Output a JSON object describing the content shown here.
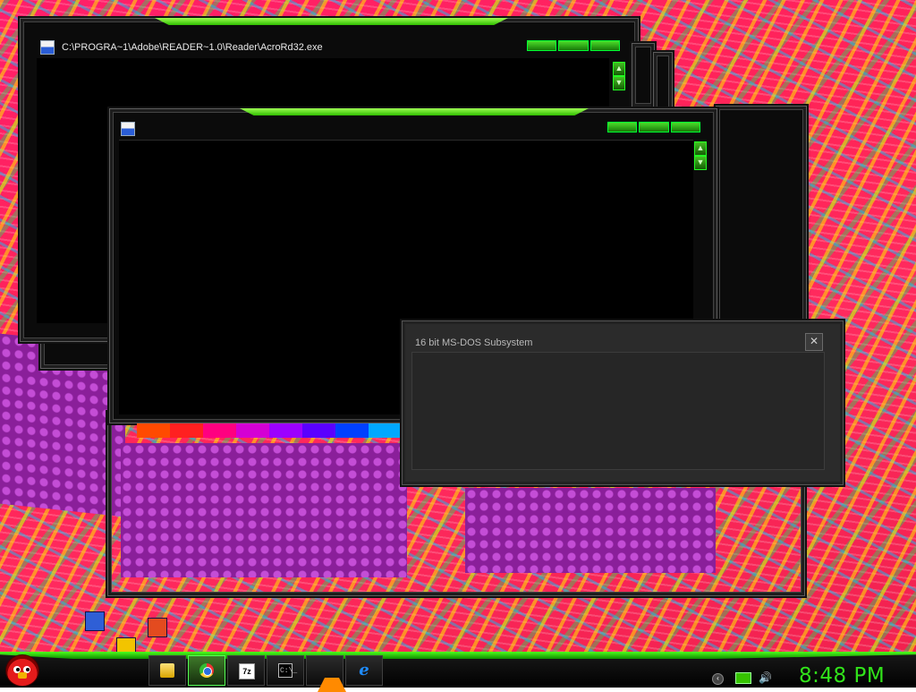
{
  "desktop": {
    "background": "psychedelic wallpaper",
    "accent_color": "#3cdc14"
  },
  "windows": {
    "acrobat": {
      "title": "C:\\PROGRA~1\\Adobe\\READER~1.0\\Reader\\AcroRd32.exe",
      "icon": "ms-dos-program-icon"
    },
    "front": {
      "title": "",
      "icon": "ms-dos-program-icon"
    }
  },
  "dialog": {
    "title": "16 bit MS-DOS Subsystem",
    "close_label": "✕"
  },
  "taskbar": {
    "start_icon": "angry-bird-icon",
    "pinned": [
      {
        "name": "explorer",
        "icon": "folder-icon",
        "active": false
      },
      {
        "name": "chrome",
        "icon": "chrome-icon",
        "active": true
      },
      {
        "name": "7-zip",
        "icon": "7zip-icon",
        "label": "7z",
        "active": false
      },
      {
        "name": "command-prompt",
        "icon": "cmd-icon",
        "label": "C:\\_",
        "active": false
      },
      {
        "name": "vlc",
        "icon": "vlc-icon",
        "active": false
      },
      {
        "name": "internet-explorer",
        "icon": "ie-icon",
        "label": "e",
        "active": false
      }
    ],
    "tray": {
      "icons": [
        "expand-arrow-icon",
        "network-monitor-icon",
        "speaker-icon"
      ],
      "speaker_glyph": "🔊",
      "arrow_glyph": "‹"
    },
    "clock": "8:48 PM"
  }
}
